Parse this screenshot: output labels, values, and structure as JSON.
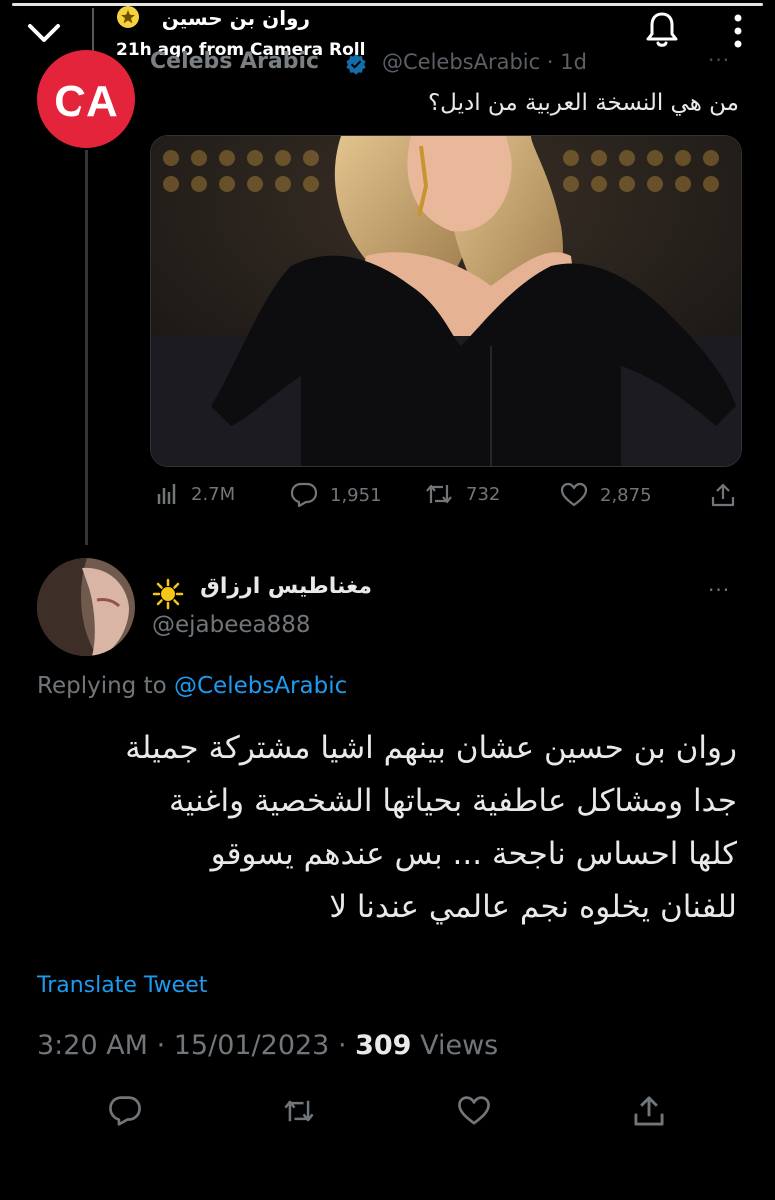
{
  "story": {
    "user_name": "روان بن حسين",
    "subtitle": "21h ago from Camera Roll"
  },
  "quoted_tweet": {
    "display_name": "Celebs Arabic",
    "handle": "@CelebsArabic",
    "time": "1d",
    "separator": "·",
    "more": "···",
    "avatar_text": "CA",
    "text": "من هي النسخة العربية من اديل؟",
    "stats": {
      "views": "2.7M",
      "replies": "1,951",
      "retweets": "732",
      "likes": "2,875"
    }
  },
  "reply": {
    "display_name": "مغناطيس ارزاق",
    "handle": "@ejabeea888",
    "more": "···",
    "replying_label": "Replying to",
    "replying_mention": "@CelebsArabic",
    "text_lines": [
      "روان بن حسين عشان بينهم اشيا مشتركة جميلة",
      "جدا ومشاكل عاطفية بحياتها الشخصية واغنية",
      "كلها احساس ناجحة ... بس عندهم يسوقو",
      "للفنان يخلوه نجم عالمي عندنا لا"
    ],
    "translate": "Translate Tweet",
    "time": "3:20 AM",
    "date": "15/01/2023",
    "sep": " · ",
    "views_count": "309",
    "views_label": "Views"
  },
  "colors": {
    "background": "#000000",
    "text": "#e7e9ea",
    "muted": "#71767b",
    "link": "#1d9bf0",
    "brand_red": "#e4243a",
    "verified": "#1d9bf0"
  },
  "icons": [
    "chevron-down-icon",
    "star-icon",
    "bell-icon",
    "more-vertical-icon",
    "verified-icon",
    "analytics-icon",
    "reply-icon",
    "retweet-icon",
    "like-icon",
    "share-icon",
    "sun-icon"
  ]
}
